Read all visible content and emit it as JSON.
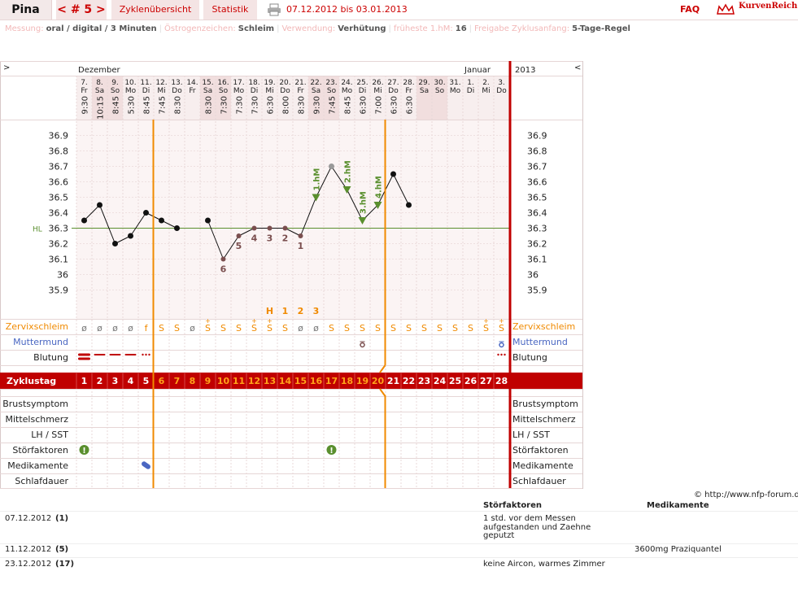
{
  "app": {
    "name": "Pina"
  },
  "nav": {
    "cycle": "< # 5 >",
    "overview": "Zyklenübersicht",
    "stats": "Statistik",
    "date_range": "07.12.2012 bis 03.01.2013",
    "faq": "FAQ",
    "logo": "KurvenReich"
  },
  "meta": [
    {
      "key": "Messung:",
      "value": "oral / digital / 3 Minuten"
    },
    {
      "key": "Östrogenzeichen:",
      "value": "Schleim"
    },
    {
      "key": "Verwendung:",
      "value": "Verhütung"
    },
    {
      "key": "früheste 1.hM:",
      "value": "16"
    },
    {
      "key": "Freigabe Zyklusanfang:",
      "value": "5-Tage-Regel"
    }
  ],
  "header": {
    "prev": ">",
    "next": "<",
    "month_left": "Dezember",
    "month_right": "Januar",
    "year": "2013"
  },
  "days": [
    {
      "d": "7.",
      "w": "Fr",
      "t": "9:30"
    },
    {
      "d": "8.",
      "w": "Sa",
      "t": "10:15"
    },
    {
      "d": "9.",
      "w": "So",
      "t": "8:45"
    },
    {
      "d": "10.",
      "w": "Mo",
      "t": "5:30"
    },
    {
      "d": "11.",
      "w": "Di",
      "t": "8:45"
    },
    {
      "d": "12.",
      "w": "Mi",
      "t": "7:45"
    },
    {
      "d": "13.",
      "w": "Do",
      "t": "8:30"
    },
    {
      "d": "14.",
      "w": "Fr",
      "t": ""
    },
    {
      "d": "15.",
      "w": "Sa",
      "t": "8:30"
    },
    {
      "d": "16.",
      "w": "So",
      "t": "7:30"
    },
    {
      "d": "17.",
      "w": "Mo",
      "t": "7:30"
    },
    {
      "d": "18.",
      "w": "Di",
      "t": "7:30"
    },
    {
      "d": "19.",
      "w": "Mi",
      "t": "6:30"
    },
    {
      "d": "20.",
      "w": "Do",
      "t": "8:00"
    },
    {
      "d": "21.",
      "w": "Fr",
      "t": "8:30"
    },
    {
      "d": "22.",
      "w": "Sa",
      "t": "9:30"
    },
    {
      "d": "23.",
      "w": "So",
      "t": "7:45"
    },
    {
      "d": "24.",
      "w": "Mo",
      "t": "8:45"
    },
    {
      "d": "25.",
      "w": "Di",
      "t": "6:30"
    },
    {
      "d": "26.",
      "w": "Mi",
      "t": "7:00"
    },
    {
      "d": "27.",
      "w": "Do",
      "t": "6:30"
    },
    {
      "d": "28.",
      "w": "Fr",
      "t": "6:30"
    },
    {
      "d": "29.",
      "w": "Sa",
      "t": ""
    },
    {
      "d": "30.",
      "w": "So",
      "t": ""
    },
    {
      "d": "31.",
      "w": "Mo",
      "t": ""
    },
    {
      "d": "1.",
      "w": "Di",
      "t": ""
    },
    {
      "d": "2.",
      "w": "Mi",
      "t": ""
    },
    {
      "d": "3.",
      "w": "Do",
      "t": ""
    }
  ],
  "chart_data": {
    "type": "line",
    "y_ticks": [
      "36.9",
      "36.8",
      "36.7",
      "36.6",
      "36.5",
      "36.4",
      "36.3",
      "36.2",
      "36.1",
      "36",
      "35.9"
    ],
    "ylim": [
      35.85,
      36.95
    ],
    "hl_label": "HL",
    "hl_value": 36.3,
    "temps": [
      36.35,
      36.45,
      36.2,
      36.25,
      36.4,
      36.35,
      36.3,
      null,
      36.35,
      36.1,
      36.25,
      36.3,
      36.3,
      36.3,
      36.25,
      36.5,
      36.7,
      36.55,
      36.35,
      36.45,
      36.65,
      36.45,
      null,
      null,
      null,
      null,
      null,
      null
    ],
    "count_labels": [
      {
        "day": 10,
        "label": "6"
      },
      {
        "day": 11,
        "label": "5"
      },
      {
        "day": 12,
        "label": "4"
      },
      {
        "day": 13,
        "label": "3"
      },
      {
        "day": 14,
        "label": "2"
      },
      {
        "day": 15,
        "label": "1"
      }
    ],
    "hm_labels": [
      {
        "day": 16,
        "label": "1.hM"
      },
      {
        "day": 18,
        "label": "2.hM"
      },
      {
        "day": 19,
        "label": "3.hM"
      },
      {
        "day": 20,
        "label": "4.hM"
      }
    ],
    "peak_labels": [
      {
        "day": 13,
        "label": "H"
      },
      {
        "day": 14,
        "label": "1"
      },
      {
        "day": 15,
        "label": "2"
      },
      {
        "day": 16,
        "label": "3"
      }
    ],
    "cervix": [
      "ø",
      "ø",
      "ø",
      "ø",
      "f",
      "S",
      "S",
      "ø",
      "S+",
      "S",
      "S",
      "S+",
      "S+",
      "S",
      "ø",
      "ø",
      "S",
      "S",
      "S",
      "S",
      "S",
      "S",
      "S",
      "S",
      "S",
      "S",
      "S+",
      "S+"
    ],
    "cycle_days": [
      "1",
      "2",
      "3",
      "4",
      "5",
      "6",
      "7",
      "8",
      "9",
      "10",
      "11",
      "12",
      "13",
      "14",
      "15",
      "16",
      "17",
      "18",
      "19",
      "20",
      "21",
      "22",
      "23",
      "24",
      "25",
      "26",
      "27",
      "28"
    ]
  },
  "rows": {
    "cervix": "Zervixschleim",
    "os": "Muttermund",
    "bleeding": "Blutung",
    "cycle_day": "Zyklustag",
    "breast": "Brustsymptom",
    "midpain": "Mittelschmerz",
    "lh": "LH / SST",
    "disturb": "Störfaktoren",
    "meds": "Medikamente",
    "sleep": "Schlafdauer"
  },
  "footer": {
    "copyright": "© http://www.nfp-forum.de",
    "col_disturb": "Störfaktoren",
    "col_meds": "Medikamente",
    "entries": [
      {
        "date": "07.12.2012",
        "day": "(1)",
        "disturb": [
          "1 std. vor dem Messen",
          "aufgestanden und Zaehne",
          "geputzt"
        ],
        "meds": ""
      },
      {
        "date": "11.12.2012",
        "day": "(5)",
        "disturb": [],
        "meds": "3600mg Praziquantel"
      },
      {
        "date": "23.12.2012",
        "day": "(17)",
        "disturb": [
          "keine Aircon, warmes Zimmer"
        ],
        "meds": ""
      }
    ]
  },
  "colors": {
    "red": "#c00000",
    "orange": "#f08a00",
    "green": "#5a8f2e",
    "pink": "#f7eeee",
    "grid": "#e8d8d8"
  }
}
